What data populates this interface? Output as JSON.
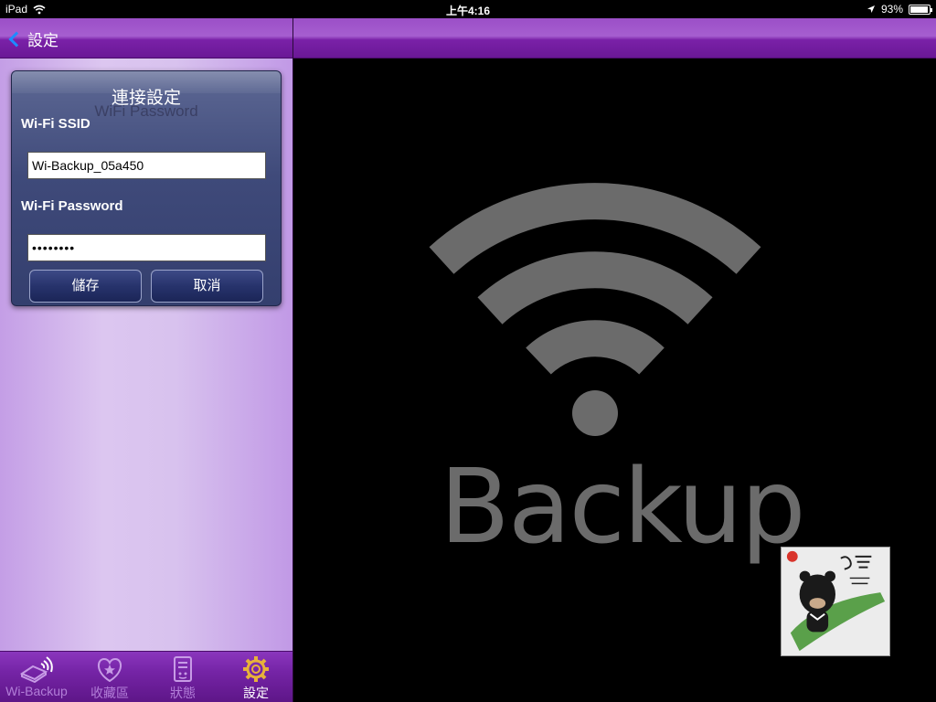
{
  "status_bar": {
    "device": "iPad",
    "time": "上午4:16",
    "battery": "93%",
    "battery_level": 0.93
  },
  "left_nav": {
    "back_label": "設定"
  },
  "dialog": {
    "title": "連接設定",
    "ghost_title": "WiFi Password",
    "ssid_label": "Wi-Fi SSID",
    "ssid_value": "Wi-Backup_05a450",
    "password_label": "Wi-Fi Password",
    "password_value": "••••••••",
    "save_label": "儲存",
    "cancel_label": "取消"
  },
  "tabs": [
    {
      "label": "Wi-Backup",
      "icon": "wibackup-icon",
      "active": false
    },
    {
      "label": "收藏區",
      "icon": "heart-star-icon",
      "active": false
    },
    {
      "label": "狀態",
      "icon": "status-document-icon",
      "active": false
    },
    {
      "label": "設定",
      "icon": "gear-icon",
      "active": true
    }
  ],
  "right_pane": {
    "wordmark": "Backup",
    "logo_icon": "wifi-icon"
  },
  "colors": {
    "nav_purple": "#7a21a8",
    "accent_blue": "#1e8bff",
    "dialog_blue": "#3f4a7a",
    "tab_active": "#ffffff",
    "tab_inactive": "#b27ed8",
    "gear_gold": "#e8b23a"
  }
}
